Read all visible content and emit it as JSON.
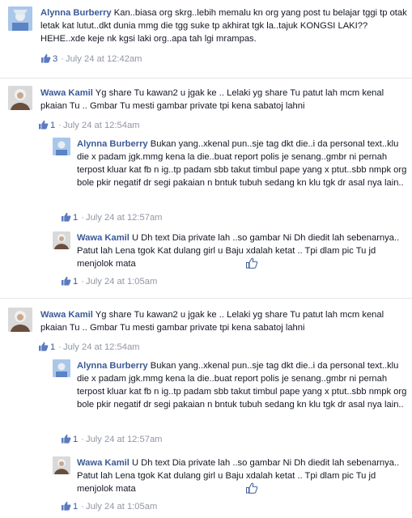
{
  "comments": [
    {
      "author": "Alynna Burberry",
      "text": "Kan..biasa org skrg..lebih memalu kn org yang post tu belajar tggi tp otak letak kat lutut..dkt dunia mmg die tgg suke tp akhirat tgk la..tajuk KONGSI LAKI??HEHE..xde keje nk kgsi laki org..apa tah lgi mrampas.",
      "likes": "3",
      "time": "July 24 at 12:42am"
    },
    {
      "author": "Wawa Kamil",
      "text": "Yg share Tu kawan2 u jgak ke .. Lelaki yg share Tu patut lah mcm kenal pkaian Tu .. Gmbar Tu mesti gambar private tpi kena sabatoj lahni",
      "likes": "1",
      "time": "July 24 at 12:54am",
      "replies": [
        {
          "author": "Alynna Burberry",
          "text": "Bukan yang..xkenal pun..sje tag dkt die..i da personal text..klu die x padam jgk.mmg kena la die..buat report polis je senang..gmbr ni pernah terpost kluar kat fb n ig..tp padam sbb takut timbul pape yang x ptut..sbb nmpk org bole pkir negatif dr segi pakaian n bntuk tubuh sedang kn klu tgk dr asal nya lain..",
          "likes": "1",
          "time": "July 24 at 12:57am"
        },
        {
          "author": "Wawa Kamil",
          "text": "U Dh text Dia private lah ..so gambar Ni Dh diedit lah sebenarnya.. Patut lah Lena tgok Kat dulang girl u Baju xdalah ketat .. Tpi dlam pic Tu jd menjolok mata",
          "likes": "1",
          "time": "July 24 at 1:05am"
        }
      ]
    },
    {
      "author": "Wawa Kamil",
      "text": "Yg share Tu kawan2 u jgak ke .. Lelaki yg share Tu patut lah mcm kenal pkaian Tu .. Gmbar Tu mesti gambar private tpi kena sabatoj lahni",
      "likes": "1",
      "time": "July 24 at 12:54am",
      "replies": [
        {
          "author": "Alynna Burberry",
          "text": "Bukan yang..xkenal pun..sje tag dkt die..i da personal text..klu die x padam jgk.mmg kena la die..buat report polis je senang..gmbr ni pernah terpost kluar kat fb n ig..tp padam sbb takut timbul pape yang x ptut..sbb nmpk org bole pkir negatif dr segi pakaian n bntuk tubuh sedang kn klu tgk dr asal nya lain..",
          "likes": "1",
          "time": "July 24 at 12:57am"
        },
        {
          "author": "Wawa Kamil",
          "text": "U Dh text Dia private lah ..so gambar Ni Dh diedit lah sebenarnya.. Patut lah Lena tgok Kat dulang girl u Baju xdalah ketat .. Tpi dlam pic Tu jd menjolok mata",
          "likes": "1",
          "time": "July 24 at 1:05am"
        }
      ]
    }
  ],
  "separator": "·",
  "colors": {
    "link": "#3b5998",
    "meta": "#9197a3",
    "text": "#141823"
  },
  "icons": {
    "like": "like-thumb-icon",
    "thumb_outline": "thumbs-up-outline-icon"
  }
}
